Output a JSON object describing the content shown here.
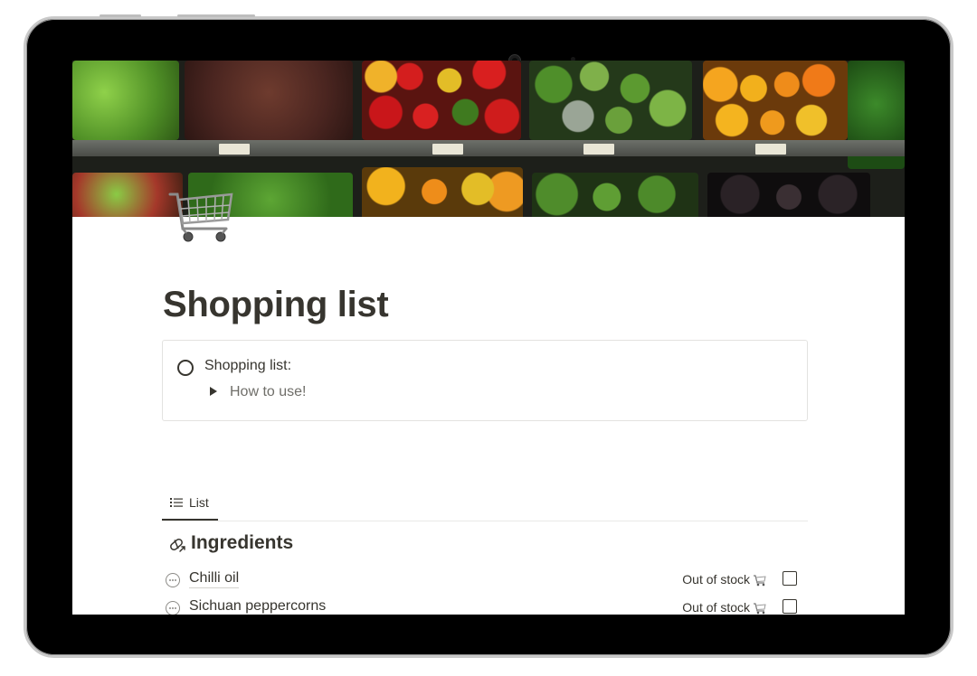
{
  "page": {
    "icon": "shopping-cart-icon",
    "title": "Shopping list"
  },
  "callout": {
    "todo_label": "Shopping list:",
    "toggle_label": "How to use!"
  },
  "view_tabs": [
    {
      "label": "List",
      "icon": "list-icon",
      "active": true
    }
  ],
  "group": {
    "icon": "pill-icon",
    "title": "Ingredients"
  },
  "items": [
    {
      "name": "Chilli oil",
      "status": "Out of stock",
      "status_icon": "shopping-cart-icon",
      "checked": false
    },
    {
      "name": "Sichuan peppercorns",
      "status": "Out of stock",
      "status_icon": "shopping-cart-icon",
      "checked": false
    }
  ],
  "colors": {
    "text": "#37352f",
    "muted": "#6f6e69",
    "border": "#e3e2e0",
    "device": "#000000"
  }
}
